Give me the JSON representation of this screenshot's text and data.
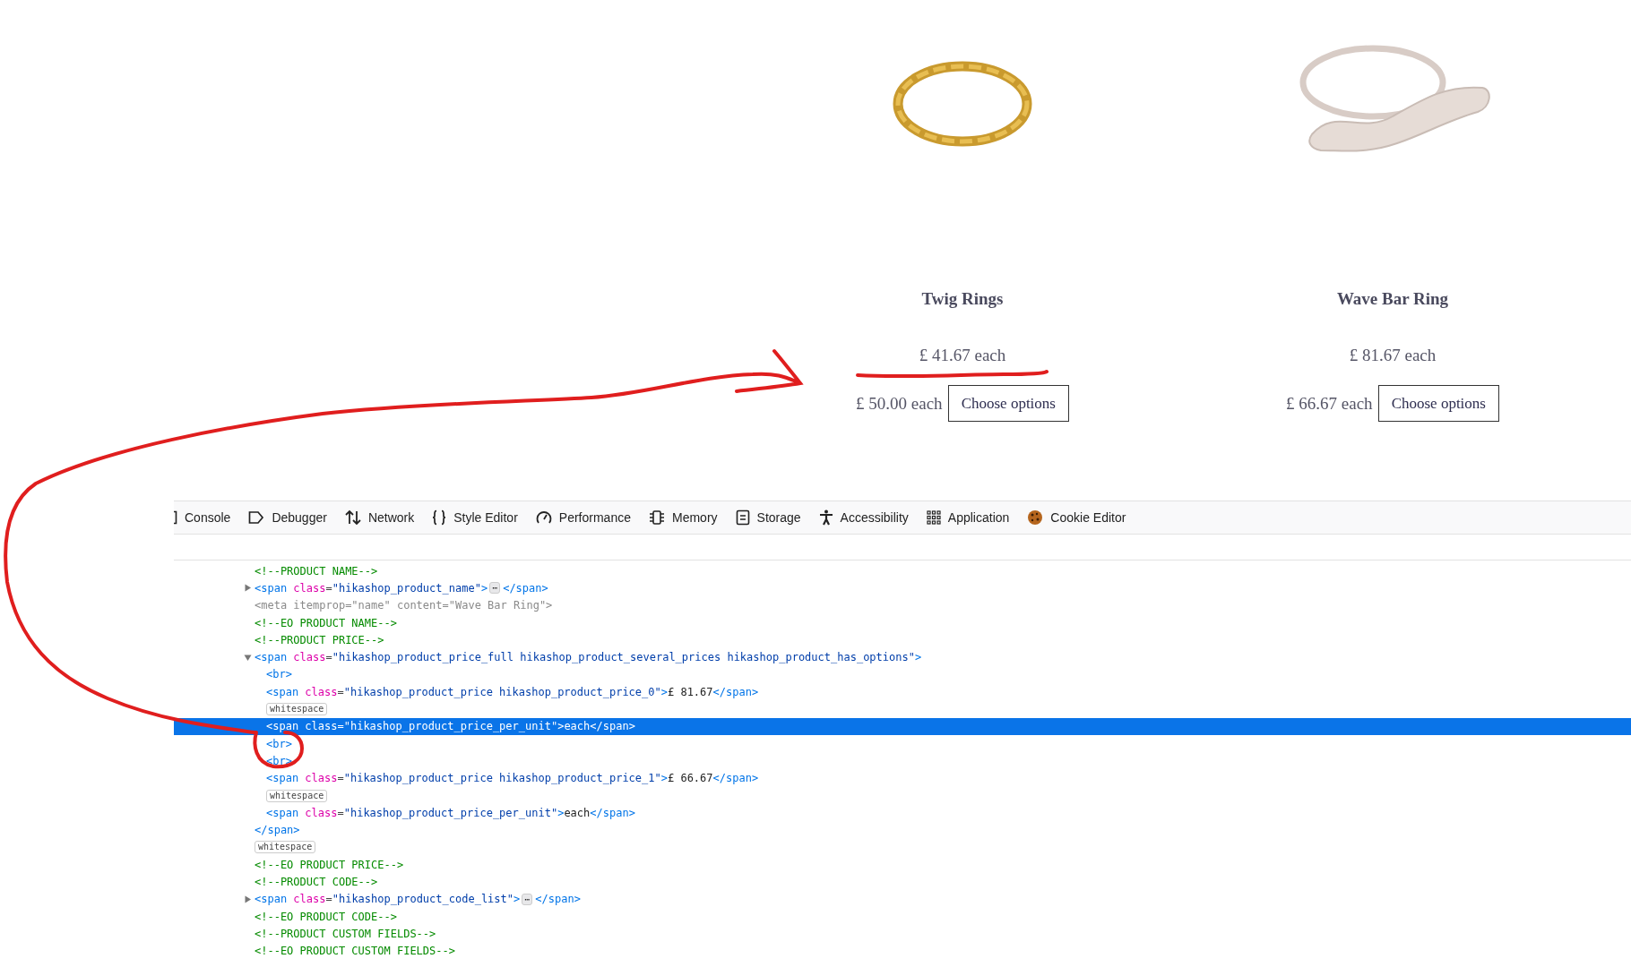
{
  "products": [
    {
      "name": "Twig Rings",
      "price": "£ 41.67 each",
      "alt_price": "£ 50.00 each",
      "button": "Choose options",
      "kind": "gold"
    },
    {
      "name": "Wave Bar Ring",
      "price": "£ 81.67 each",
      "alt_price": "£ 66.67 each",
      "button": "Choose options",
      "kind": "silver"
    }
  ],
  "devtools_tabs": [
    {
      "label": "Console",
      "kind": "console"
    },
    {
      "label": "Debugger",
      "kind": "debugger"
    },
    {
      "label": "Network",
      "kind": "network"
    },
    {
      "label": "Style Editor",
      "kind": "style"
    },
    {
      "label": "Performance",
      "kind": "performance"
    },
    {
      "label": "Memory",
      "kind": "memory"
    },
    {
      "label": "Storage",
      "kind": "storage"
    },
    {
      "label": "Accessibility",
      "kind": "accessibility"
    },
    {
      "label": "Application",
      "kind": "application"
    },
    {
      "label": "Cookie Editor",
      "kind": "cookie"
    }
  ],
  "markup_lines": [
    {
      "kind": "comment",
      "text": "<!--PRODUCT NAME-->",
      "selected": false
    },
    {
      "kind": "element",
      "text": "<span class=\"hikashop_product_name\">",
      "badge": "⋯",
      "tail": "</span>",
      "expanded": false,
      "selected": false
    },
    {
      "kind": "dimmed",
      "text": "<meta itemprop=\"name\" content=\"Wave Bar Ring\">",
      "selected": false
    },
    {
      "kind": "comment",
      "text": "<!--EO PRODUCT NAME-->",
      "selected": false
    },
    {
      "kind": "comment",
      "text": "<!--PRODUCT PRICE-->",
      "selected": false
    },
    {
      "kind": "element",
      "text": "<span class=\"hikashop_product_price_full hikashop_product_several_prices hikashop_product_has_options\">",
      "expanded": true,
      "selected": false,
      "children": [
        {
          "kind": "element",
          "text": "<br>",
          "selected": false
        },
        {
          "kind": "element",
          "text": "<span class=\"hikashop_product_price hikashop_product_price_0\">£ 81.67</span>",
          "selected": false
        },
        {
          "kind": "whitespace",
          "text": "whitespace",
          "selected": false
        },
        {
          "kind": "element",
          "text": "<span class=\"hikashop_product_price_per_unit\">each</span>",
          "selected": true
        },
        {
          "kind": "element",
          "text": "<br>",
          "selected": false
        },
        {
          "kind": "element",
          "text": "<br>",
          "selected": false
        },
        {
          "kind": "element",
          "text": "<span class=\"hikashop_product_price hikashop_product_price_1\">£ 66.67</span>",
          "selected": false
        },
        {
          "kind": "whitespace",
          "text": "whitespace",
          "selected": false
        },
        {
          "kind": "element",
          "text": "<span class=\"hikashop_product_price_per_unit\">each</span>",
          "selected": false
        }
      ]
    },
    {
      "kind": "element",
      "text": "</span>",
      "selected": false
    },
    {
      "kind": "whitespace",
      "text": "whitespace",
      "selected": false
    },
    {
      "kind": "comment",
      "text": "<!--EO PRODUCT PRICE-->",
      "selected": false
    },
    {
      "kind": "comment",
      "text": "<!--PRODUCT CODE-->",
      "selected": false
    },
    {
      "kind": "element",
      "text": "<span class=\"hikashop_product_code_list\">",
      "badge": "⋯",
      "tail": "</span>",
      "expanded": false,
      "selected": false
    },
    {
      "kind": "comment",
      "text": "<!--EO PRODUCT CODE-->",
      "selected": false
    },
    {
      "kind": "comment",
      "text": "<!--PRODUCT CUSTOM FIELDS-->",
      "selected": false
    },
    {
      "kind": "comment",
      "text": "<!--EO PRODUCT CUSTOM FIELDS-->",
      "selected": false
    }
  ]
}
